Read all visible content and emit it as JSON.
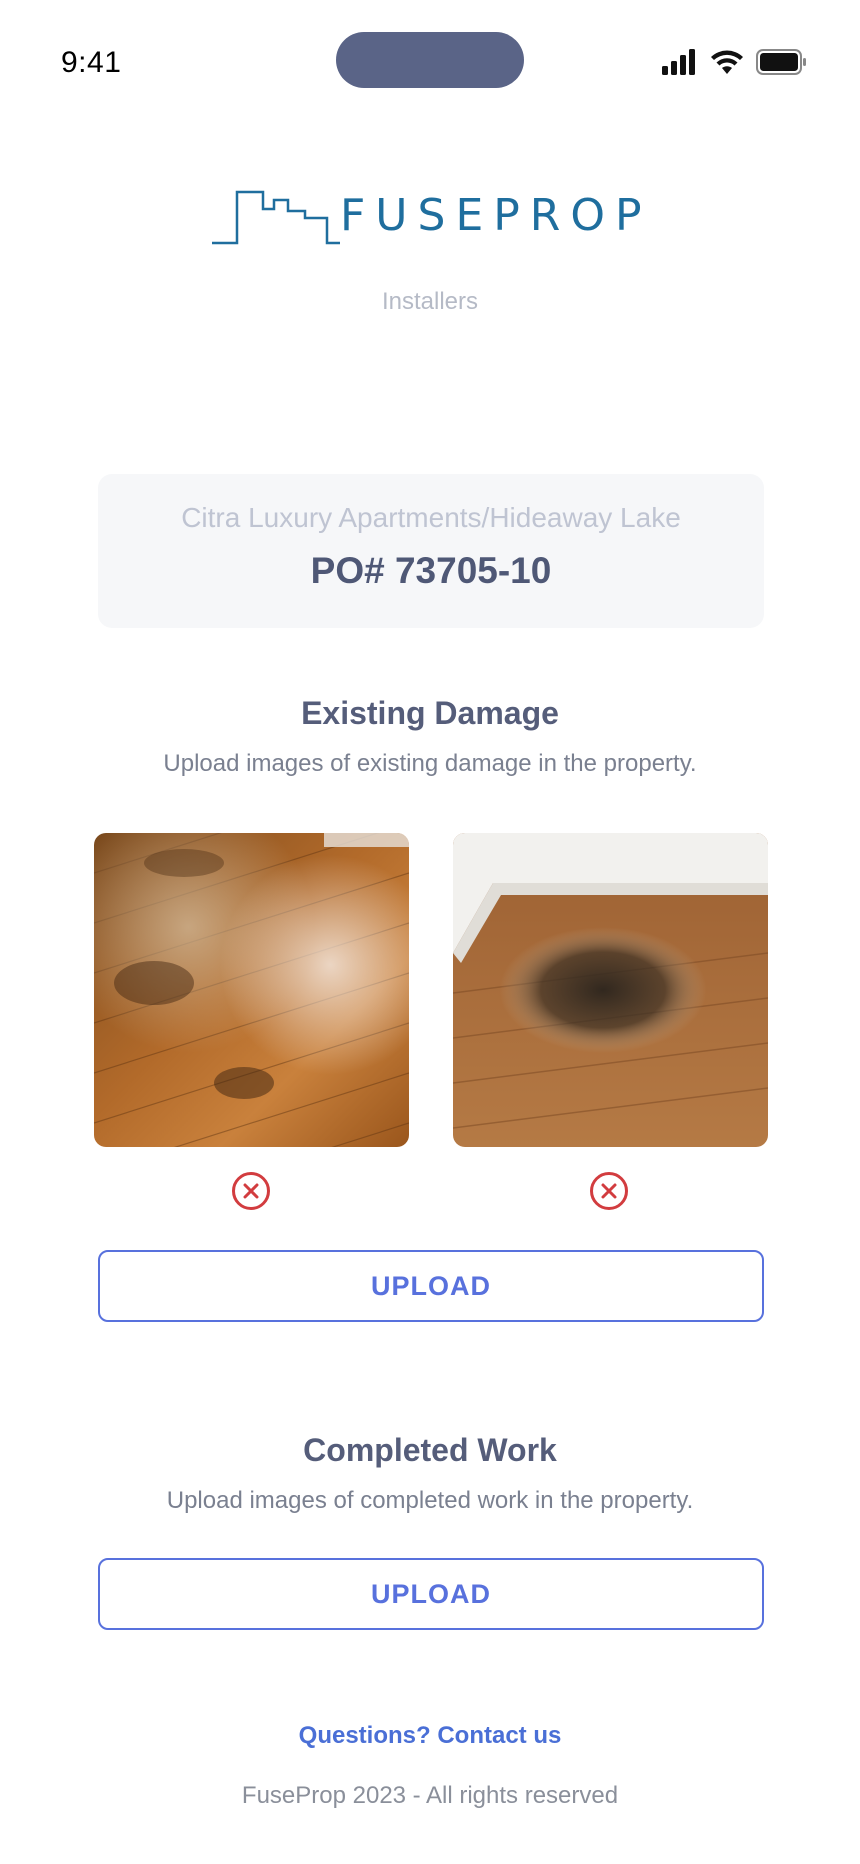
{
  "status_bar": {
    "time": "9:41",
    "icons": [
      "cellular-signal-icon",
      "wifi-icon",
      "battery-icon"
    ]
  },
  "brand": {
    "logo_text": "FUSEPROP",
    "subtitle": "Installers",
    "color": "#1f6e9e"
  },
  "property": {
    "name": "Citra Luxury Apartments/Hideaway Lake",
    "po": "PO# 73705-10"
  },
  "existing_damage": {
    "title": "Existing Damage",
    "description": "Upload images of existing damage in the property.",
    "images": [
      {
        "description": "Damaged hardwood floor with worn, stained finish"
      },
      {
        "description": "Hardwood floor with dark water damage stain near baseboard"
      }
    ],
    "remove_icon": "close-circle-icon",
    "upload_label": "UPLOAD"
  },
  "completed_work": {
    "title": "Completed Work",
    "description": "Upload images of completed work in the property.",
    "upload_label": "UPLOAD"
  },
  "footer": {
    "contact": "Questions? Contact us",
    "copyright": "FuseProp 2023 - All rights reserved"
  },
  "colors": {
    "accent": "#5871dd",
    "remove": "#d23c3f",
    "heading": "#555d7a"
  }
}
